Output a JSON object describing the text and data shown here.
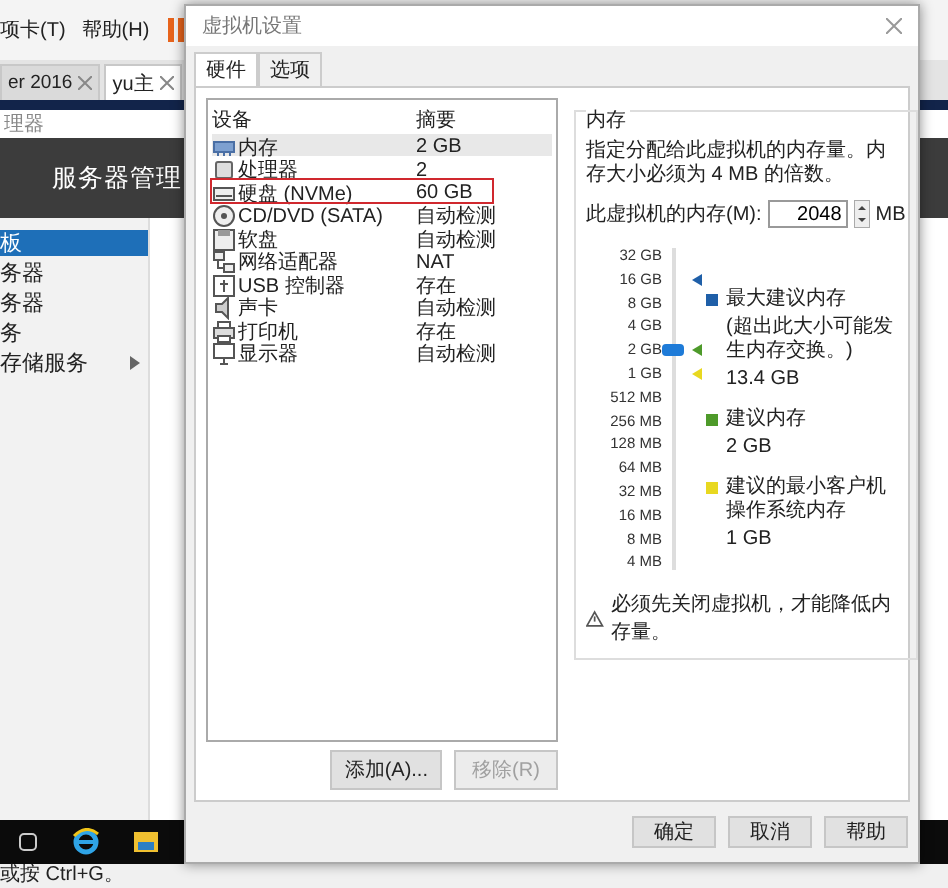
{
  "background": {
    "menu": [
      "项卡(T)",
      "帮助(H)"
    ],
    "tabs": [
      {
        "label": "er 2016",
        "selected": false
      },
      {
        "label": "yu主",
        "selected": true
      }
    ],
    "breadcrumb": "理器",
    "header": "服务器管理",
    "sidebar": [
      {
        "label": "板",
        "selected": true,
        "expandable": false
      },
      {
        "label": "务器",
        "selected": false,
        "expandable": false
      },
      {
        "label": "务器",
        "selected": false,
        "expandable": false
      },
      {
        "label": "务",
        "selected": false,
        "expandable": false
      },
      {
        "label": "存储服务",
        "selected": false,
        "expandable": true
      }
    ],
    "status_bar": "或按 Ctrl+G。"
  },
  "dialog": {
    "title": "虚拟机设置",
    "tabs": [
      {
        "label": "硬件",
        "selected": true
      },
      {
        "label": "选项",
        "selected": false
      }
    ],
    "columns": [
      "设备",
      "摘要"
    ],
    "devices": [
      {
        "kind": "memory",
        "name": "内存",
        "summary": "2 GB",
        "selected": true,
        "outlined": false
      },
      {
        "kind": "cpu",
        "name": "处理器",
        "summary": "2",
        "selected": false,
        "outlined": false
      },
      {
        "kind": "disk",
        "name": "硬盘 (NVMe)",
        "summary": "60 GB",
        "selected": false,
        "outlined": true
      },
      {
        "kind": "cd",
        "name": "CD/DVD (SATA)",
        "summary": "自动检测",
        "selected": false,
        "outlined": false
      },
      {
        "kind": "floppy",
        "name": "软盘",
        "summary": "自动检测",
        "selected": false,
        "outlined": false
      },
      {
        "kind": "network",
        "name": "网络适配器",
        "summary": "NAT",
        "selected": false,
        "outlined": false
      },
      {
        "kind": "usb",
        "name": "USB 控制器",
        "summary": "存在",
        "selected": false,
        "outlined": false
      },
      {
        "kind": "sound",
        "name": "声卡",
        "summary": "自动检测",
        "selected": false,
        "outlined": false
      },
      {
        "kind": "printer",
        "name": "打印机",
        "summary": "存在",
        "selected": false,
        "outlined": false
      },
      {
        "kind": "display",
        "name": "显示器",
        "summary": "自动检测",
        "selected": false,
        "outlined": false
      }
    ],
    "buttons": [
      {
        "label": "添加(A)...",
        "disabled": false
      },
      {
        "label": "移除(R)",
        "disabled": true
      }
    ],
    "memory": {
      "group_label": "内存",
      "description": "指定分配给此虚拟机的内存量。内存大小必须为 4 MB 的倍数。",
      "field_label": "此虚拟机的内存(M):",
      "value": "2048",
      "unit": "MB",
      "scale": [
        "32 GB",
        "16 GB",
        "8 GB",
        "4 GB",
        "2 GB",
        "1 GB",
        "512 MB",
        "256 MB",
        "128 MB",
        "64 MB",
        "32 MB",
        "16 MB",
        "8 MB",
        "4 MB"
      ],
      "level": 0.692,
      "markers": [
        {
          "color": "#1f5fa8",
          "level": 0.923
        },
        {
          "color": "#4e9a2a",
          "level": 0.692
        },
        {
          "color": "#e8d820",
          "level": 0.615
        }
      ],
      "legend": [
        {
          "color": "#1f5fa8",
          "title": "最大建议内存",
          "note": "(超出此大小可能发生内存交换。)",
          "value": "13.4 GB"
        },
        {
          "color": "#4e9a2a",
          "title": "建议内存",
          "value": "2 GB"
        },
        {
          "color": "#e8d820",
          "title": "建议的最小客户机操作系统内存",
          "value": "1 GB"
        }
      ],
      "warning": "必须先关闭虚拟机，才能降低内存量。"
    },
    "footer_buttons": [
      "确定",
      "取消",
      "帮助"
    ]
  }
}
